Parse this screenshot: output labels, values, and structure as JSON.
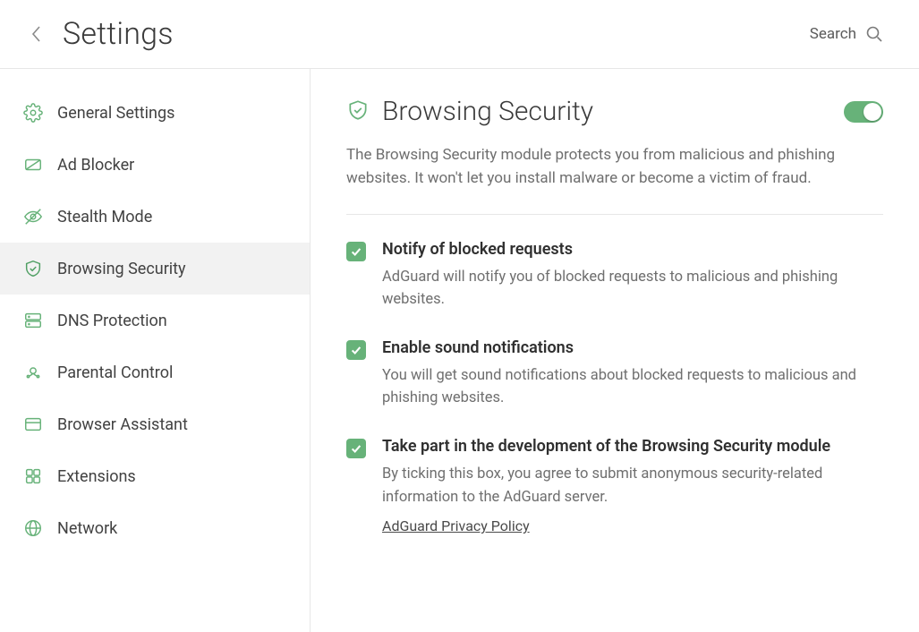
{
  "header": {
    "title": "Settings",
    "search_label": "Search"
  },
  "sidebar": {
    "items": [
      {
        "id": "general",
        "label": "General Settings",
        "icon": "gear-icon",
        "active": false
      },
      {
        "id": "adblocker",
        "label": "Ad Blocker",
        "icon": "adblock-icon",
        "active": false
      },
      {
        "id": "stealth",
        "label": "Stealth Mode",
        "icon": "stealth-icon",
        "active": false
      },
      {
        "id": "security",
        "label": "Browsing Security",
        "icon": "shield-icon",
        "active": true
      },
      {
        "id": "dns",
        "label": "DNS Protection",
        "icon": "dns-icon",
        "active": false
      },
      {
        "id": "parental",
        "label": "Parental Control",
        "icon": "parental-icon",
        "active": false
      },
      {
        "id": "assistant",
        "label": "Browser Assistant",
        "icon": "assistant-icon",
        "active": false
      },
      {
        "id": "extensions",
        "label": "Extensions",
        "icon": "extensions-icon",
        "active": false
      },
      {
        "id": "network",
        "label": "Network",
        "icon": "network-icon",
        "active": false
      }
    ]
  },
  "main": {
    "title": "Browsing Security",
    "enabled": true,
    "description": "The Browsing Security module protects you from malicious and phishing websites. It won't let you install malware or become a victim of fraud.",
    "options": [
      {
        "id": "notify",
        "checked": true,
        "title": "Notify of blocked requests",
        "desc": "AdGuard will notify you of blocked requests to malicious and phishing websites."
      },
      {
        "id": "sound",
        "checked": true,
        "title": "Enable sound notifications",
        "desc": "You will get sound notifications about blocked requests to malicious and phishing websites."
      },
      {
        "id": "participate",
        "checked": true,
        "title": "Take part in the development of the Browsing Security module",
        "desc": "By ticking this box, you agree to submit anonymous security-related information to the AdGuard server.",
        "link": "AdGuard Privacy Policy"
      }
    ]
  }
}
